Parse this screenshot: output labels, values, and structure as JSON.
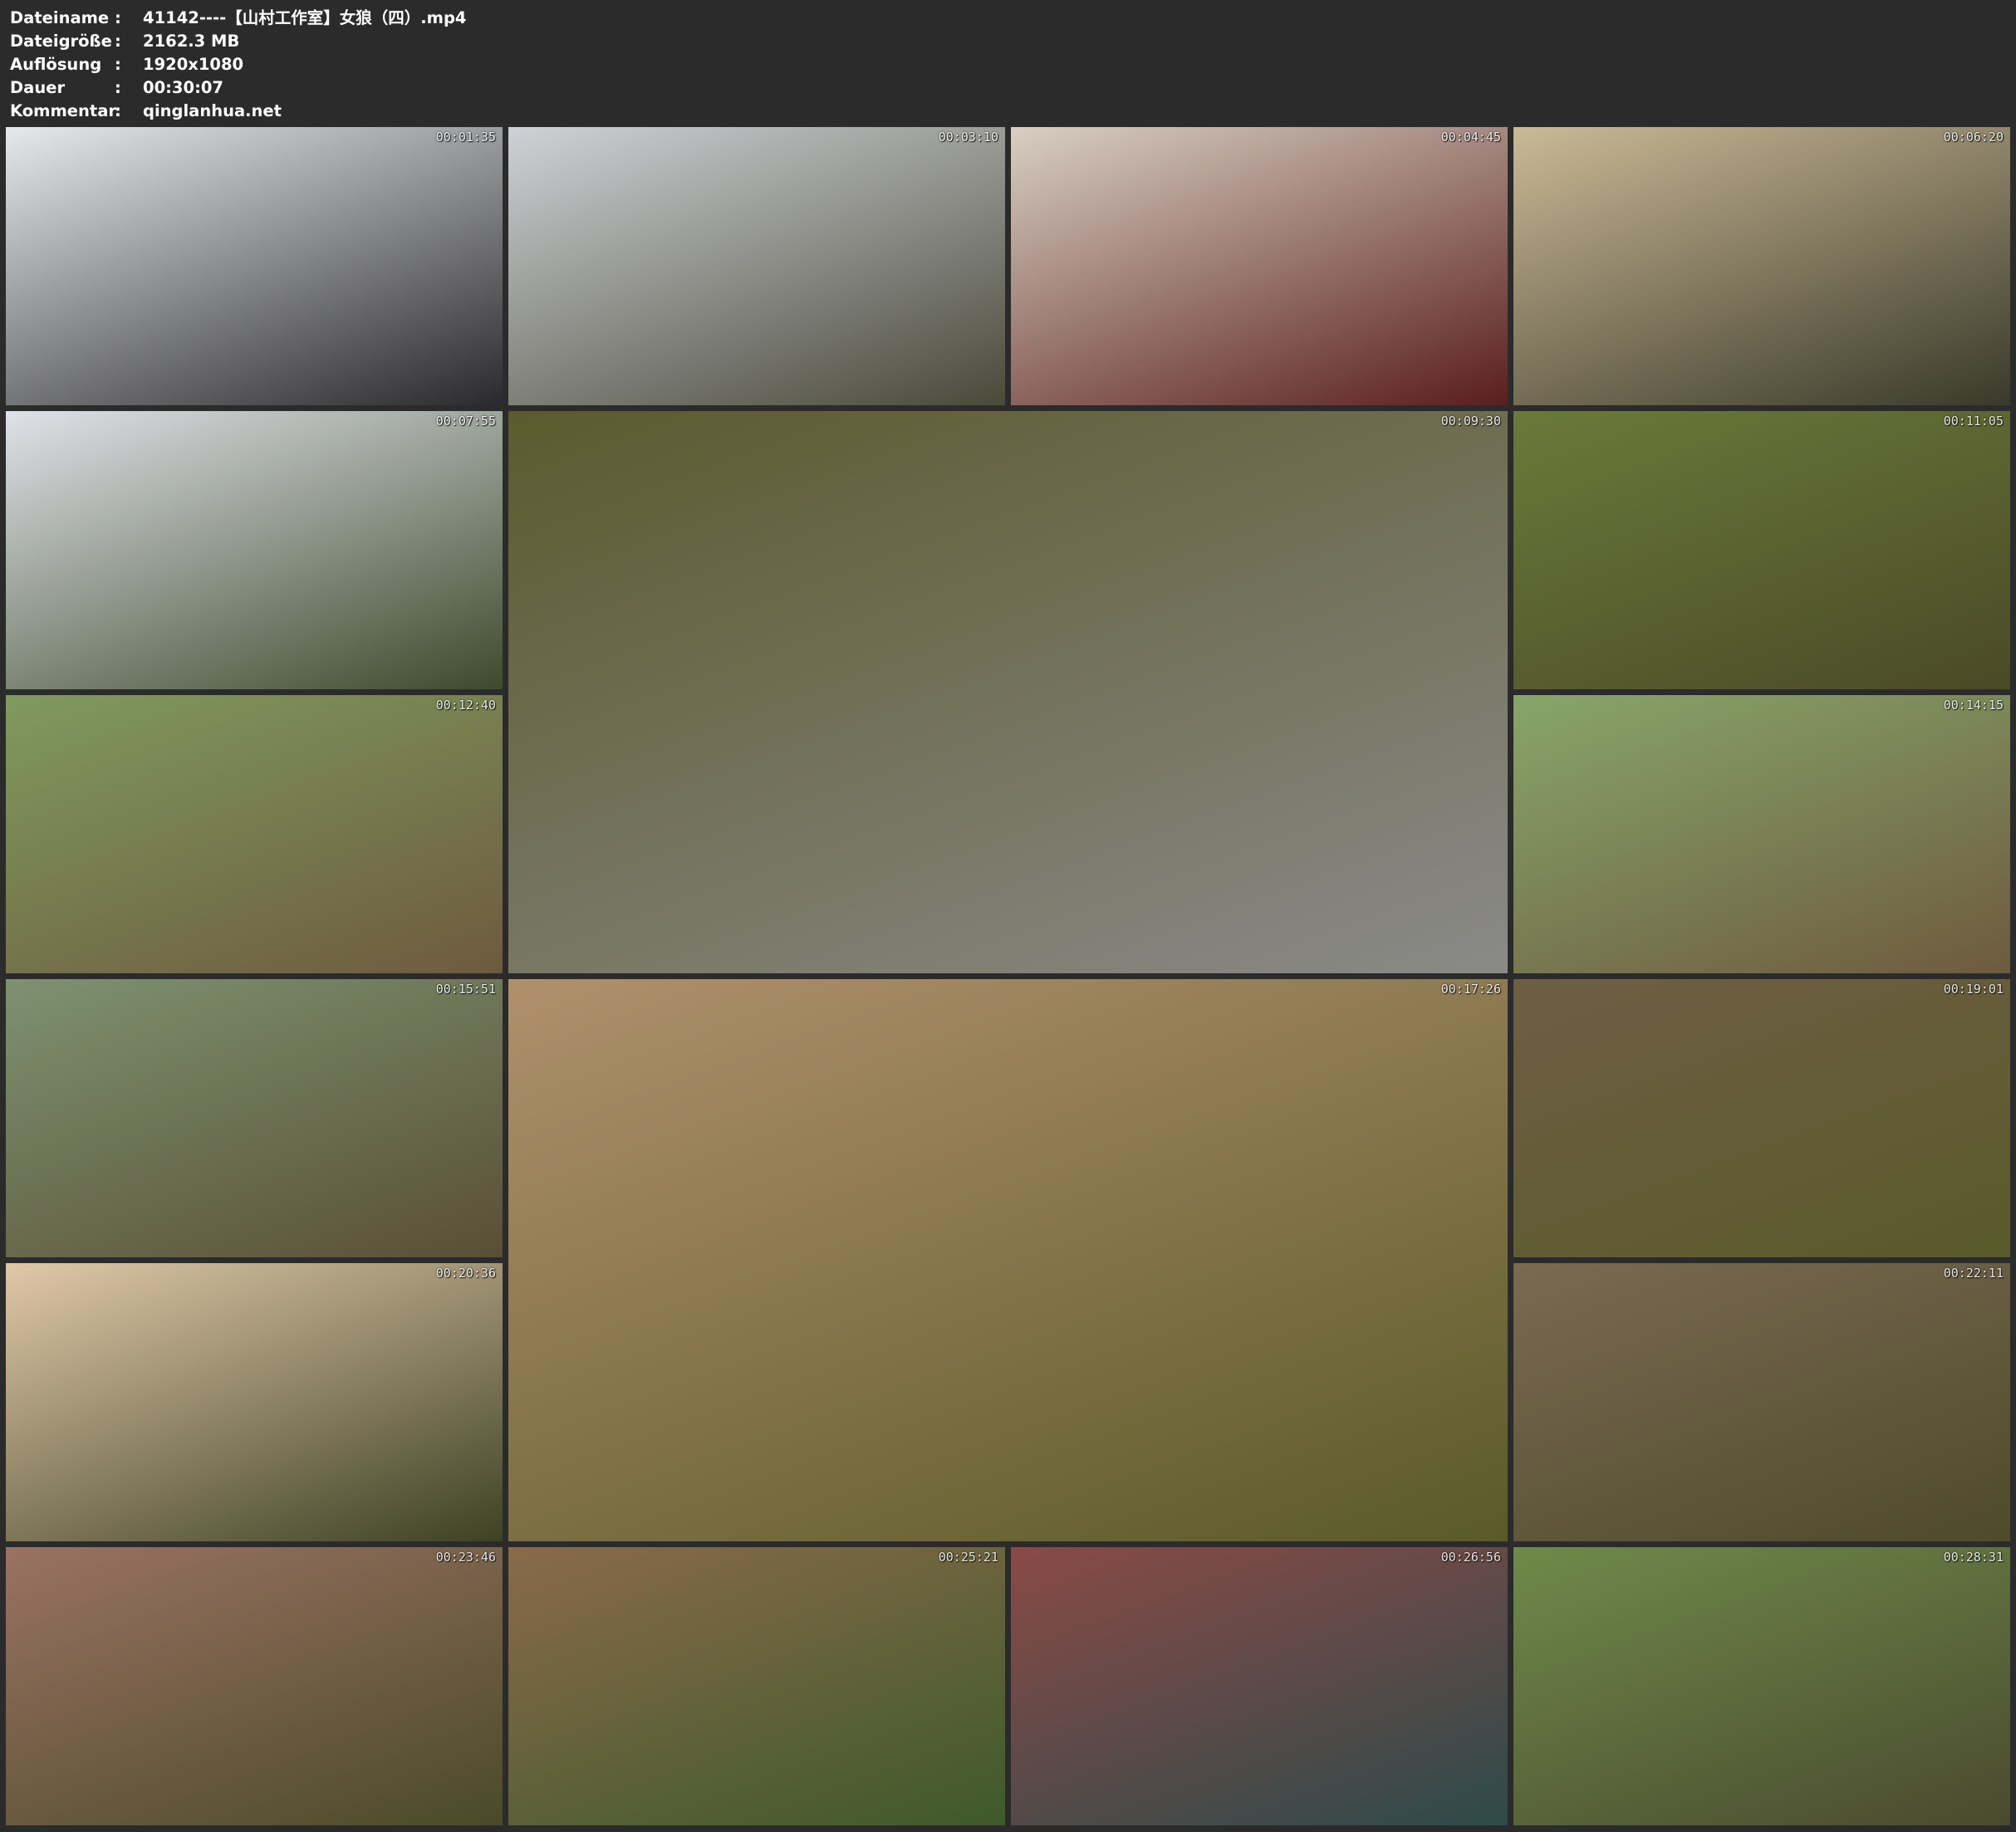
{
  "info": [
    {
      "key": "Dateiname",
      "sep": ":",
      "value": "41142----【山村工作室】女狼（四）.mp4"
    },
    {
      "key": "Dateigröße",
      "sep": ":",
      "value": "2162.3 MB"
    },
    {
      "key": "Auflösung",
      "sep": ":",
      "value": "1920x1080"
    },
    {
      "key": "Dauer",
      "sep": ":",
      "value": "00:30:07"
    },
    {
      "key": "Kommentar",
      "sep": ":",
      "value": "qinglanhua.net"
    }
  ],
  "thumbnails": [
    {
      "timestamp": "00:01:35",
      "colors": [
        "#e6e8ea",
        "#2a2a2c"
      ]
    },
    {
      "timestamp": "00:03:10",
      "colors": [
        "#cfd2d6",
        "#4a4a3a"
      ]
    },
    {
      "timestamp": "00:04:45",
      "colors": [
        "#d8cfc2",
        "#5a1e1e"
      ]
    },
    {
      "timestamp": "00:06:20",
      "colors": [
        "#cbb996",
        "#3a3a2a"
      ]
    },
    {
      "timestamp": "00:07:55",
      "colors": [
        "#dfe2e8",
        "#3e4a2c"
      ]
    },
    {
      "timestamp": "00:09:30",
      "colors": [
        "#5c5a2e",
        "#8a8a88"
      ]
    },
    {
      "timestamp": "00:11:05",
      "colors": [
        "#6a7a3a",
        "#4a4a26"
      ]
    },
    {
      "timestamp": "00:12:40",
      "colors": [
        "#7f9a5e",
        "#6e5a3e"
      ]
    },
    {
      "timestamp": "00:14:15",
      "colors": [
        "#87a66a",
        "#6e5a3e"
      ]
    },
    {
      "timestamp": "00:15:51",
      "colors": [
        "#7d9270",
        "#5a4e36"
      ]
    },
    {
      "timestamp": "00:17:26",
      "colors": [
        "#b0906c",
        "#5a5a28"
      ]
    },
    {
      "timestamp": "00:19:01",
      "colors": [
        "#6e5e44",
        "#5a5a2a"
      ]
    },
    {
      "timestamp": "00:20:36",
      "colors": [
        "#e0c8a8",
        "#3e4224"
      ]
    },
    {
      "timestamp": "00:22:11",
      "colors": [
        "#7a6a52",
        "#4e4a2a"
      ]
    },
    {
      "timestamp": "00:23:46",
      "colors": [
        "#9a7262",
        "#4a4a28"
      ]
    },
    {
      "timestamp": "00:25:21",
      "colors": [
        "#8a6a4a",
        "#3e5a2a"
      ]
    },
    {
      "timestamp": "00:26:56",
      "colors": [
        "#8a4a46",
        "#2e4a4a"
      ]
    },
    {
      "timestamp": "00:28:31",
      "colors": [
        "#6e8a4a",
        "#4a4a2e"
      ]
    }
  ]
}
